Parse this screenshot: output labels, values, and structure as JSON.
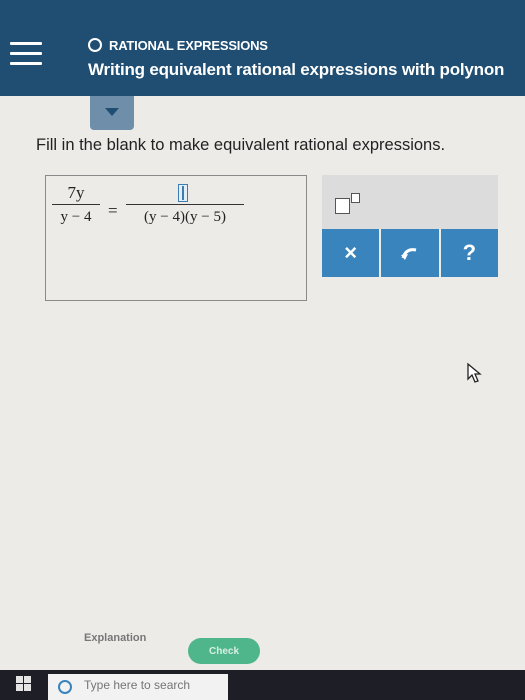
{
  "header": {
    "topic": "RATIONAL EXPRESSIONS",
    "title": "Writing equivalent rational expressions with polynon"
  },
  "question": {
    "instruction": "Fill in the blank to make equivalent rational expressions.",
    "left_numerator": "7y",
    "left_denominator": "y − 4",
    "equals": "=",
    "right_denominator": "(y − 4)(y − 5)"
  },
  "toolbar": {
    "clear_label": "×",
    "help_label": "?"
  },
  "footer": {
    "explanation_label": "Explanation",
    "check_label": "Check"
  },
  "taskbar": {
    "search_placeholder": "Type here to search"
  },
  "colors": {
    "header_bg": "#1f4e72",
    "accent": "#3a84bd",
    "check": "#4fb68b"
  }
}
